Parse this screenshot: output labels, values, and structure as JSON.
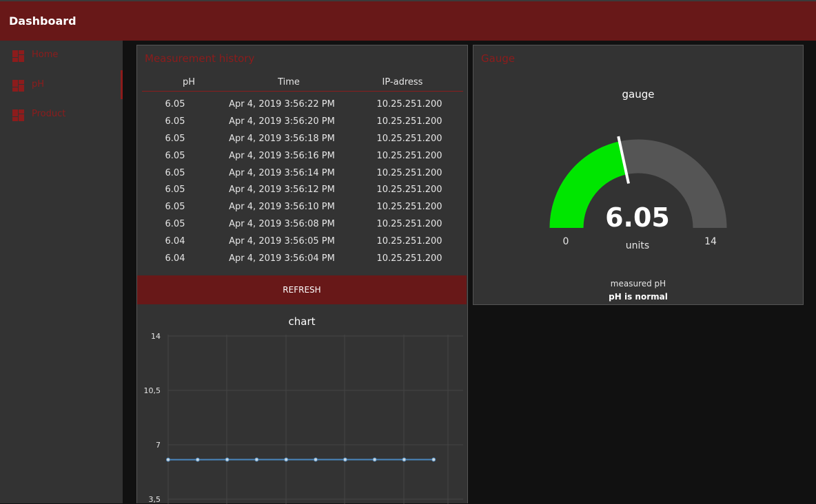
{
  "header": {
    "title": "Dashboard"
  },
  "sidebar": {
    "items": [
      {
        "label": "Home",
        "icon": "dashboard-icon"
      },
      {
        "label": "pH",
        "icon": "dashboard-icon"
      },
      {
        "label": "Product",
        "icon": "dashboard-icon"
      }
    ],
    "active": "pH"
  },
  "history": {
    "title": "Measurement history",
    "columns": [
      "pH",
      "Time",
      "IP-adress"
    ],
    "rows": [
      [
        "6.05",
        "Apr 4, 2019 3:56:22 PM",
        "10.25.251.200"
      ],
      [
        "6.05",
        "Apr 4, 2019 3:56:20 PM",
        "10.25.251.200"
      ],
      [
        "6.05",
        "Apr 4, 2019 3:56:18 PM",
        "10.25.251.200"
      ],
      [
        "6.05",
        "Apr 4, 2019 3:56:16 PM",
        "10.25.251.200"
      ],
      [
        "6.05",
        "Apr 4, 2019 3:56:14 PM",
        "10.25.251.200"
      ],
      [
        "6.05",
        "Apr 4, 2019 3:56:12 PM",
        "10.25.251.200"
      ],
      [
        "6.05",
        "Apr 4, 2019 3:56:10 PM",
        "10.25.251.200"
      ],
      [
        "6.05",
        "Apr 4, 2019 3:56:08 PM",
        "10.25.251.200"
      ],
      [
        "6.04",
        "Apr 4, 2019 3:56:05 PM",
        "10.25.251.200"
      ],
      [
        "6.04",
        "Apr 4, 2019 3:56:04 PM",
        "10.25.251.200"
      ]
    ],
    "refresh_label": "REFRESH"
  },
  "gauge": {
    "card_title": "Gauge",
    "title": "gauge",
    "value": "6.05",
    "min": "0",
    "max": "14",
    "units": "units",
    "caption": "measured pH",
    "status": "pH is normal",
    "fill_color": "#00e600",
    "track_color": "#555555"
  },
  "chart_data": {
    "type": "line",
    "title": "chart",
    "y_ticks": [
      "14",
      "10,5",
      "7",
      "3,5"
    ],
    "ylim": [
      0,
      14
    ],
    "grid": true,
    "series": [
      {
        "values": [
          6.04,
          6.04,
          6.05,
          6.05,
          6.05,
          6.05,
          6.05,
          6.05,
          6.05,
          6.05
        ]
      }
    ],
    "color": "#4a88c0"
  },
  "colors": {
    "accent": "#8c1c1c",
    "header": "#681818",
    "panel": "#333333"
  }
}
